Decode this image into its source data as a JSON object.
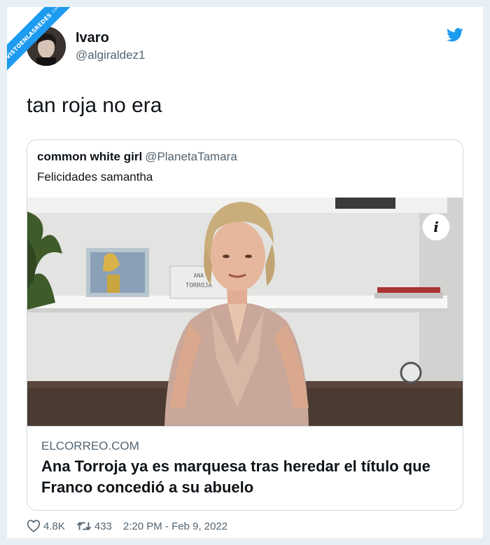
{
  "watermark": {
    "text": "VISTOENLASREDES",
    "sub": ".com"
  },
  "tweet": {
    "display_name": "Ivaro",
    "handle": "@algiraldez1",
    "text": "tan roja no era",
    "likes": "4.8K",
    "retweets": "433",
    "timestamp": "2:20 PM - Feb 9, 2022"
  },
  "quoted": {
    "display_name": "common white girl",
    "handle": "@PlanetaTamara",
    "text": "Felicidades samantha",
    "link_card": {
      "domain": "ELCORREO.COM",
      "headline": "Ana Torroja ya es marquesa tras heredar el título que Franco concedió a su abuelo",
      "info_label": "i"
    }
  },
  "colors": {
    "brand": "#1d9bf0",
    "secondary_text": "#536471",
    "border": "#cfd9de"
  },
  "icons": [
    "twitter-bird-icon",
    "info-icon",
    "heart-icon",
    "retweet-icon"
  ]
}
